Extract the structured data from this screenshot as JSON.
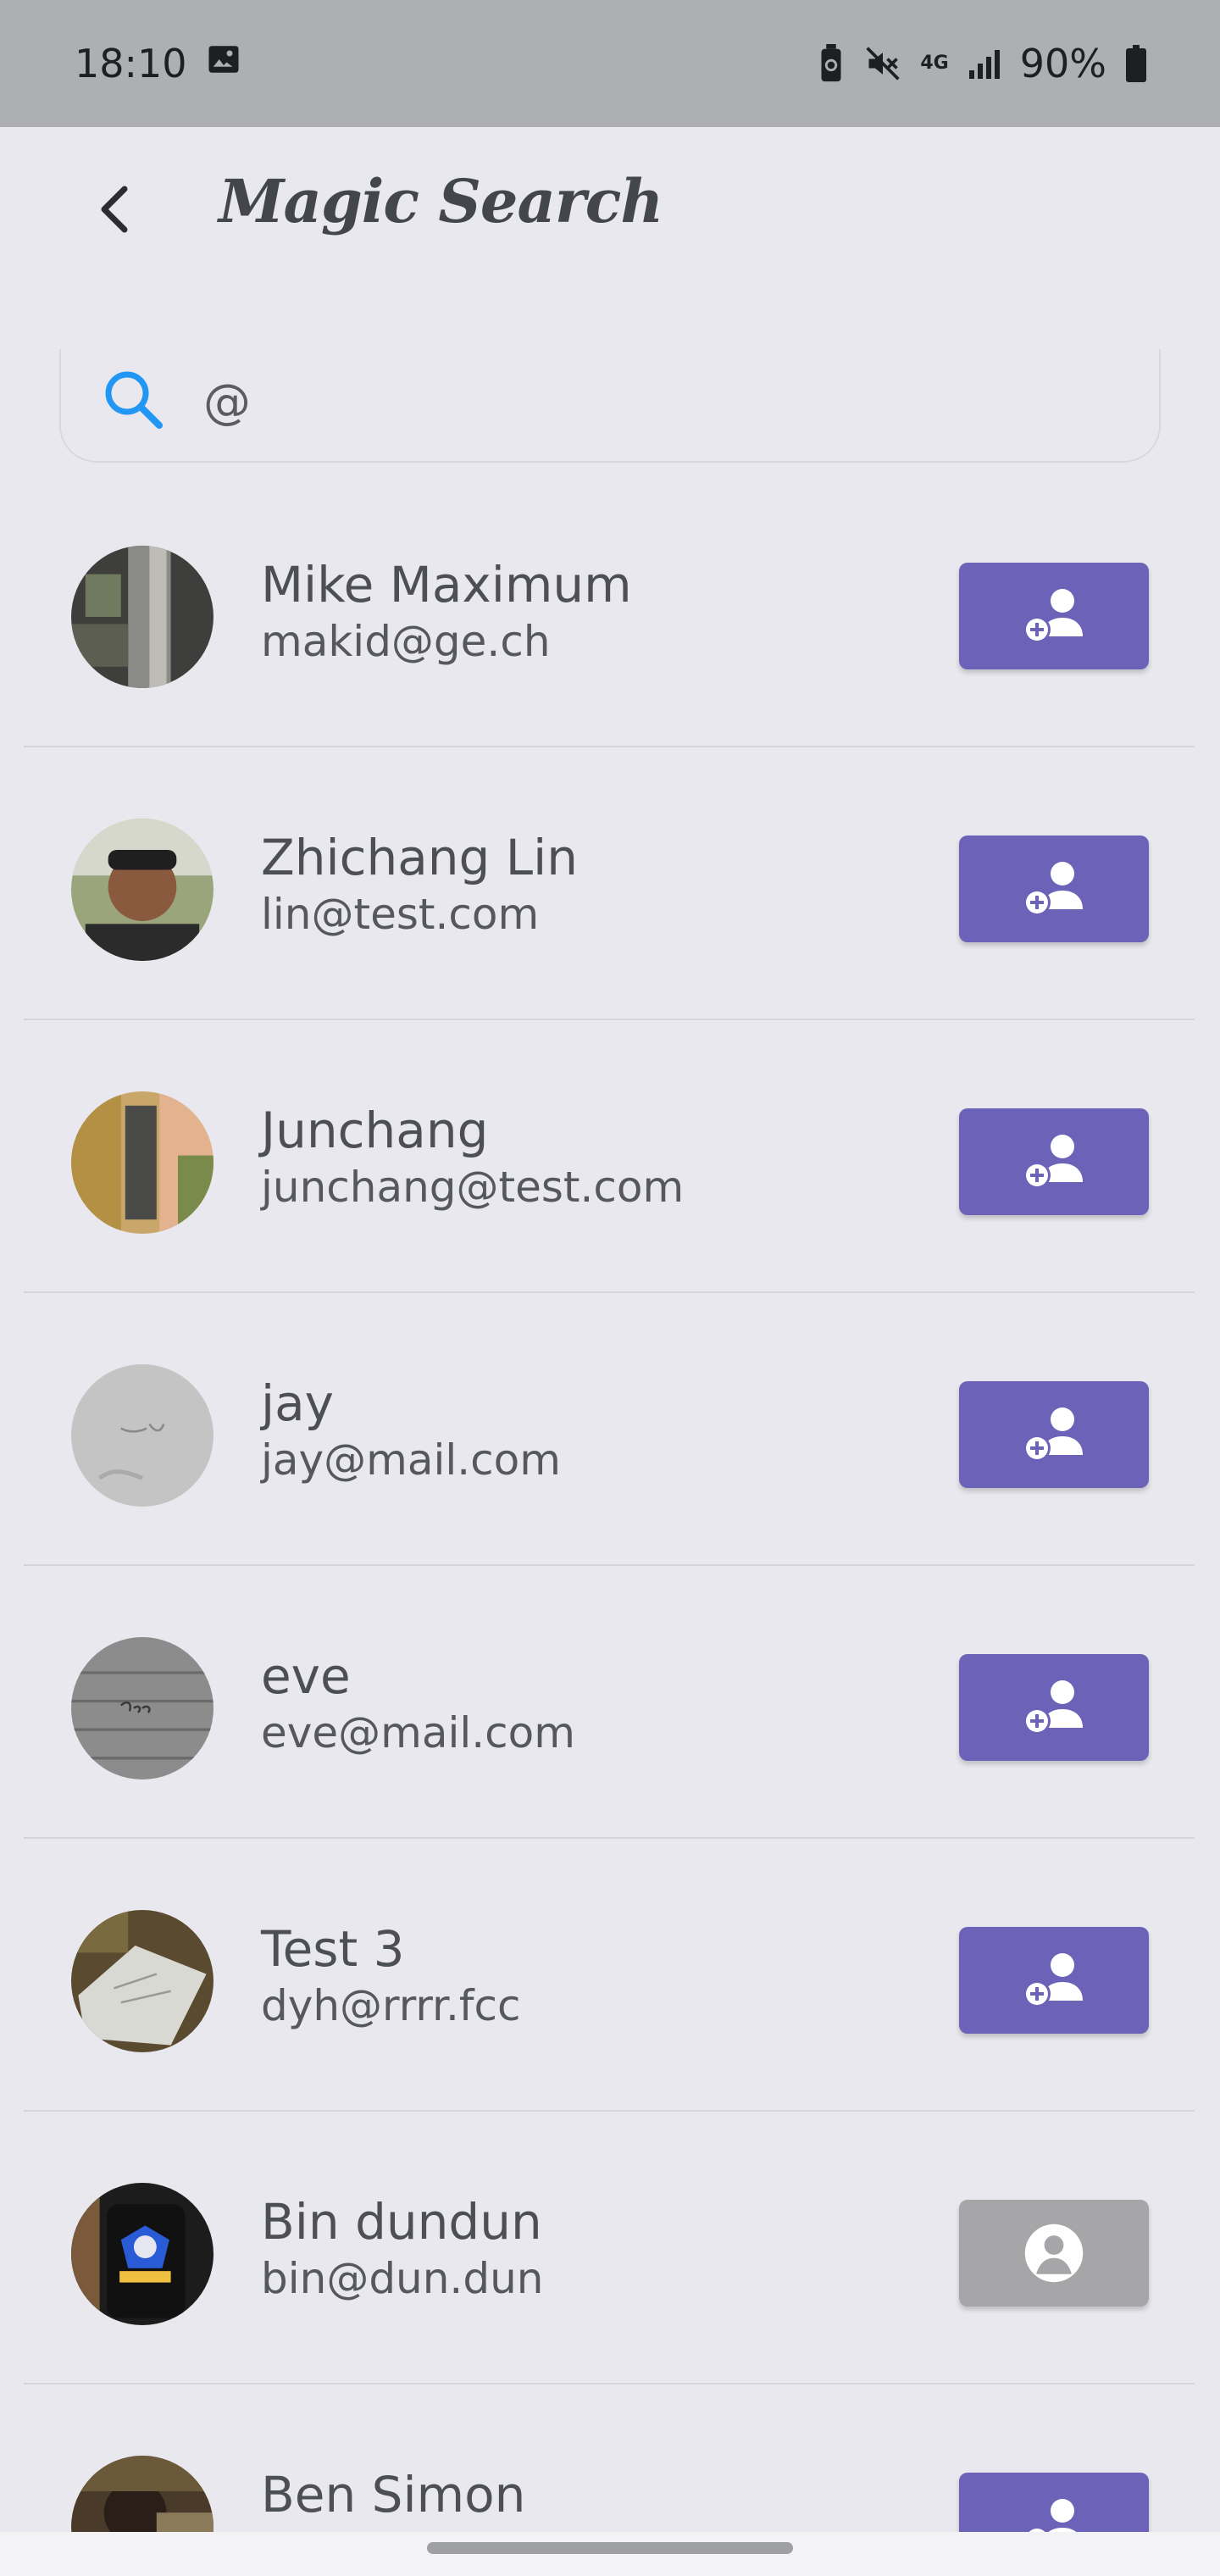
{
  "status_bar": {
    "time": "18:10",
    "battery": "90%",
    "network_label": "4G",
    "icons": [
      "image-icon",
      "battery-saver-icon",
      "mute-icon",
      "signal-icon",
      "battery-icon"
    ]
  },
  "header": {
    "title": "Magic Search",
    "back_icon": "chevron-left-icon"
  },
  "search": {
    "value": "@",
    "icon": "search-icon",
    "accent_color": "#2196f3"
  },
  "colors": {
    "add_button": "#6c63b8",
    "profile_button": "#a6a6a8",
    "background": "#e8e8ee"
  },
  "users": [
    {
      "name": "Mike Maximum",
      "email": "makid@ge.ch",
      "action": "add-friend",
      "action_icon": "add-user-icon"
    },
    {
      "name": "Zhichang Lin",
      "email": "lin@test.com",
      "action": "add-friend",
      "action_icon": "add-user-icon"
    },
    {
      "name": "Junchang",
      "email": "junchang@test.com",
      "action": "add-friend",
      "action_icon": "add-user-icon"
    },
    {
      "name": "jay",
      "email": "jay@mail.com",
      "action": "add-friend",
      "action_icon": "add-user-icon"
    },
    {
      "name": "eve",
      "email": "eve@mail.com",
      "action": "add-friend",
      "action_icon": "add-user-icon"
    },
    {
      "name": "Test 3",
      "email": "dyh@rrrr.fcc",
      "action": "add-friend",
      "action_icon": "add-user-icon"
    },
    {
      "name": "Bin dundun",
      "email": "bin@dun.dun",
      "action": "view-profile",
      "action_icon": "user-profile-icon"
    },
    {
      "name": "Ben Simon",
      "email": "",
      "action": "add-friend",
      "action_icon": "add-user-icon"
    }
  ]
}
